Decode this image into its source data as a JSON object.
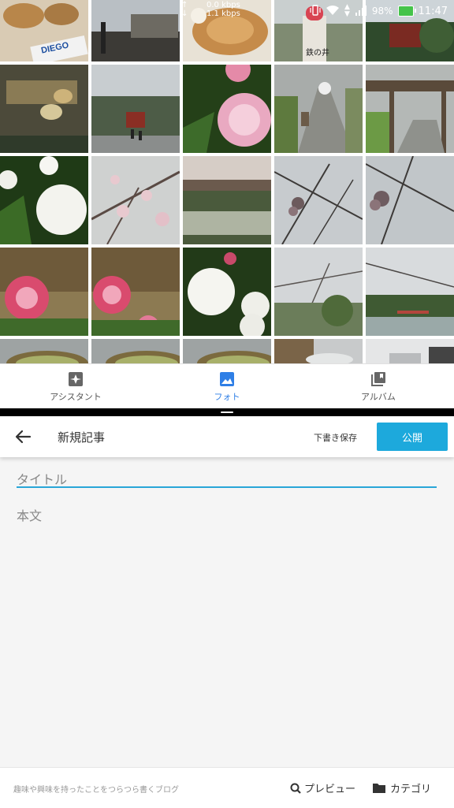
{
  "status_bar": {
    "upload_speed": "0.0 kbps",
    "download_speed": "1.1 kbps",
    "battery": "98%",
    "time": "11:47"
  },
  "photo_grid": {
    "sign_diego": "DIEGO",
    "sign_shop": "鉄の井"
  },
  "bottom_nav": {
    "items": [
      {
        "label": "アシスタント",
        "icon": "assistant-icon"
      },
      {
        "label": "フォト",
        "icon": "photo-icon",
        "active": true
      },
      {
        "label": "アルバム",
        "icon": "album-icon"
      }
    ]
  },
  "editor": {
    "title": "新規記事",
    "draft_label": "下書き保存",
    "publish_label": "公開",
    "title_placeholder": "タイトル",
    "body_placeholder": "本文"
  },
  "footer": {
    "blog_description": "趣味や興味を持ったことをつらつら書くブログ",
    "preview_label": "プレビュー",
    "category_label": "カテゴリ"
  },
  "colors": {
    "accent": "#1da9dc",
    "nav_active": "#2f7fe6"
  }
}
